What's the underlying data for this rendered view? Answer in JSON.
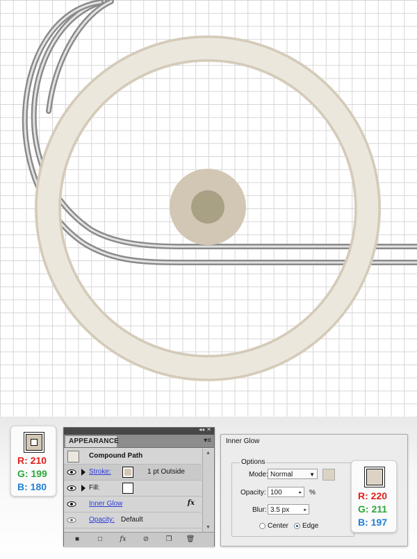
{
  "left_swatch": {
    "color": "#d2c7b4",
    "r_label": "R: 210",
    "g_label": "G: 199",
    "b_label": "B: 180"
  },
  "appearance_panel": {
    "tab_label": "APPEARANCE",
    "menu_icon": "panel-menu-icon",
    "object_label": "Compound Path",
    "rows": [
      {
        "label": "Stroke:",
        "value": "1 pt  Outside",
        "swatch": "#d2c7b4"
      },
      {
        "label": "Fill:",
        "value": "",
        "swatch": "none"
      },
      {
        "label": "Inner Glow",
        "value": "",
        "fx": "fx"
      },
      {
        "label": "Opacity:",
        "value": "Default"
      }
    ],
    "toolbar_icons": [
      "new-art-icon",
      "clear-icon",
      "add-effect-icon",
      "delete-icon",
      "duplicate-icon",
      "trash-icon"
    ]
  },
  "inner_glow": {
    "title": "Inner Glow",
    "options_label": "Options",
    "mode_label": "Mode:",
    "mode_value": "Normal",
    "mode_color": "#dcd3c5",
    "opacity_label": "Opacity:",
    "opacity_value": "100",
    "opacity_unit": "%",
    "blur_label": "Blur:",
    "blur_value": "3.5 px",
    "center_label": "Center",
    "edge_label": "Edge",
    "selected": "Edge"
  },
  "right_swatch": {
    "color": "#dcd3c5",
    "r_label": "R: 220",
    "g_label": "G: 211",
    "b_label": "B: 197"
  },
  "colors": {
    "ring": "#ebe7dd",
    "ring_edge": "#d6ccbb",
    "hub_outer": "#d2c7b4",
    "hub_inner": "#a8a184",
    "tube": "#b4b4b4"
  }
}
